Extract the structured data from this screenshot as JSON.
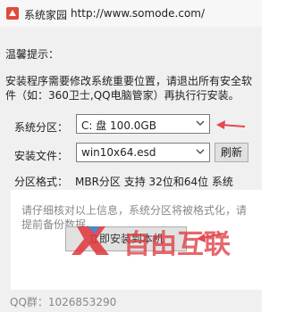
{
  "window": {
    "title": "系统家园",
    "url": "http://www.somode.com/"
  },
  "tips": {
    "heading": "温馨提示：",
    "text": "安装程序需要修改系统重要位置，请退出所有安全软件（如：360卫士,QQ电脑管家）再执行行安装。"
  },
  "partition": {
    "label": "系统分区：",
    "value": "C: 盘 100.0GB"
  },
  "install_file": {
    "label": "安装文件：",
    "value": "win10x64.esd",
    "refresh_label": "刷新"
  },
  "partition_format": {
    "label": "分区格式：",
    "value": "MBR分区 支持 32位和64位 系统"
  },
  "footer": {
    "warning": "请仔细核对以上信息，系统分区将被格式化，请提前备份数据。",
    "install_button": "立即安装到本机",
    "qq": "QQ群：1026853290"
  },
  "watermark": {
    "text": "自由互联"
  },
  "colors": {
    "arrow": "#e5484d",
    "watermark_red": "#e0353c",
    "watermark_blue": "#3a78c8"
  }
}
